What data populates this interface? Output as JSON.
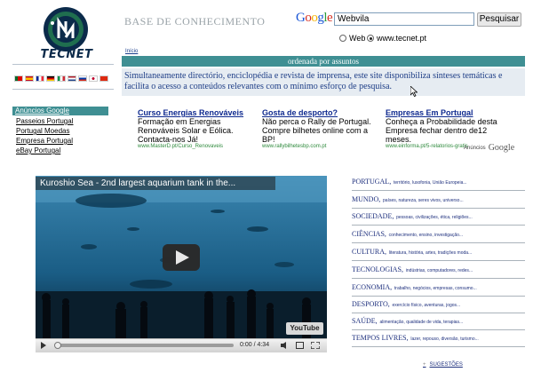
{
  "brand": {
    "name": "TECNET",
    "site_title": "BASE DE CONHECIMENTO"
  },
  "search": {
    "google_label": "Google",
    "query": "Webvila",
    "button_label": "Pesquisar",
    "option_web": "Web",
    "option_site": "www.tecnet.pt",
    "selected": "www.tecnet.pt"
  },
  "breadcrumb": {
    "home": "Início"
  },
  "header_bar": "ordenada por assuntos",
  "description": "Simultaneamente directório, enciclopédia e revista de imprensa, este site disponibiliza sínteses temáticas e facilita o acesso a conteúdos relevantes com o mínimo esforço de pesquisa.",
  "flags": [
    "pt",
    "es",
    "fr",
    "de",
    "it",
    "nl",
    "ru",
    "jp",
    "cn"
  ],
  "nav": {
    "header": "Anúncios Google",
    "items": [
      "Passeios Portugal",
      "Portugal Moedas",
      "Empresa Portugal",
      "eBay Portugal"
    ]
  },
  "ads": [
    {
      "title": "Curso Energias Renováveis",
      "text": "Formação em Energias Renováveis Solar e Eólica. Contacta-nos Já!",
      "url": "www.MasterD.pt/Curso_Renovaveis"
    },
    {
      "title": "Gosta de desporto?",
      "text": "Não perca o Rally de Portugal. Compre bilhetes online com a BP!",
      "url": "www.rallybilhetesbp.com.pt"
    },
    {
      "title": "Empresas Em Portugal",
      "text": "Conheça a Probabilidade desta Empresa fechar dentro de12 meses.",
      "url": "www.einforma.pt/5-relatorios-gratis"
    }
  ],
  "ads_label": "Anúncios",
  "ads_google": "Google",
  "video": {
    "title": "Kuroshio Sea - 2nd largest aquarium tank in the...",
    "time": "0:00 / 4:34",
    "badge": "YouTube",
    "progress": 0
  },
  "categories": [
    {
      "name": "PORTUGAL,",
      "sub": "território, lusofonia, União Europeia..."
    },
    {
      "name": "MUNDO,",
      "sub": "países, natureza, seres vivos, universo..."
    },
    {
      "name": "SOCIEDADE,",
      "sub": "pessoas, civilizações, ética, religiões..."
    },
    {
      "name": "CIÊNCIAS,",
      "sub": "conhecimento, ensino, investigação..."
    },
    {
      "name": "CULTURA,",
      "sub": "literatura, história, artes, tradições moda..."
    },
    {
      "name": "TECNOLOGIAS,",
      "sub": "indústrias, computadores, redes..."
    },
    {
      "name": "ECONOMIA,",
      "sub": "trabalho, negócios, empresas, consumo..."
    },
    {
      "name": "DESPORTO,",
      "sub": "exercício físico, aventuras, jogos..."
    },
    {
      "name": "SAÚDE,",
      "sub": "alimentação, qualidade de vida, terapias..."
    },
    {
      "name": "TEMPOS LIVRES,",
      "sub": "lazer, repouso, diversão, turismo..."
    }
  ],
  "suggestions_label": "SUGESTÕES",
  "colors": {
    "teal": "#3f8f93",
    "link_blue": "#1d2f7d",
    "desc_bg": "#e6ecf2"
  }
}
